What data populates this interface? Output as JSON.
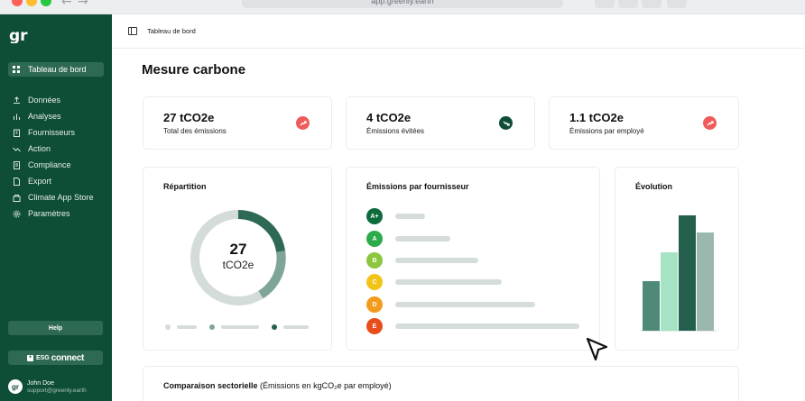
{
  "browser": {
    "url": "app.greenly.earth"
  },
  "sidebar": {
    "logo": "gr",
    "items": [
      {
        "label": "Tableau de bord",
        "icon": "grid-icon",
        "active": true
      },
      {
        "label": "Données",
        "icon": "upload-icon"
      },
      {
        "label": "Analyses",
        "icon": "bar-chart-icon"
      },
      {
        "label": "Fournisseurs",
        "icon": "building-icon"
      },
      {
        "label": "Action",
        "icon": "trend-icon"
      },
      {
        "label": "Compliance",
        "icon": "document-icon"
      },
      {
        "label": "Export",
        "icon": "file-icon"
      },
      {
        "label": "Climate App Store",
        "icon": "store-icon"
      },
      {
        "label": "Paramètres",
        "icon": "gear-icon"
      }
    ],
    "help_label": "Help",
    "esg": {
      "small": "ESG",
      "big": "connect"
    },
    "user": {
      "initials": "gr",
      "name": "John Doe",
      "email": "support@greenly.earth"
    }
  },
  "header": {
    "breadcrumb": "Tableau de bord"
  },
  "page": {
    "title": "Mesure carbone"
  },
  "stats": [
    {
      "value": "27 tCO2e",
      "label": "Total des émissions",
      "trend": "up",
      "color": "#ef5b5b"
    },
    {
      "value": "4 tCO2e",
      "label": "Émissions évitées",
      "trend": "down",
      "color": "#0e4d36"
    },
    {
      "value": "1.1 tCO2e",
      "label": "Émissions par employé",
      "trend": "up",
      "color": "#ef5b5b"
    }
  ],
  "repartition": {
    "title": "Répartition",
    "total": "27",
    "unit": "tCO2e"
  },
  "suppliers": {
    "title": "Émissions par fournisseur",
    "grades": [
      {
        "grade": "A+",
        "color": "#0e6b3c",
        "level": 0.16
      },
      {
        "grade": "A",
        "color": "#2cab4a",
        "level": 0.3
      },
      {
        "grade": "B",
        "color": "#8cc63e",
        "level": 0.45
      },
      {
        "grade": "C",
        "color": "#f2c417",
        "level": 0.58
      },
      {
        "grade": "D",
        "color": "#f39b1c",
        "level": 0.76
      },
      {
        "grade": "E",
        "color": "#e84e1b",
        "level": 1.0
      }
    ]
  },
  "evolution": {
    "title": "Évolution",
    "bars": [
      {
        "level": 0.43,
        "color": "#4f8a78"
      },
      {
        "level": 0.68,
        "color": "#a6e3c4"
      },
      {
        "level": 1.0,
        "color": "#245f4d"
      },
      {
        "level": 0.85,
        "color": "#9ab8ae"
      }
    ]
  },
  "sector": {
    "title_bold": "Comparaison sectorielle",
    "title_rest": " (Émissions en kgCO₂e par employé)"
  }
}
